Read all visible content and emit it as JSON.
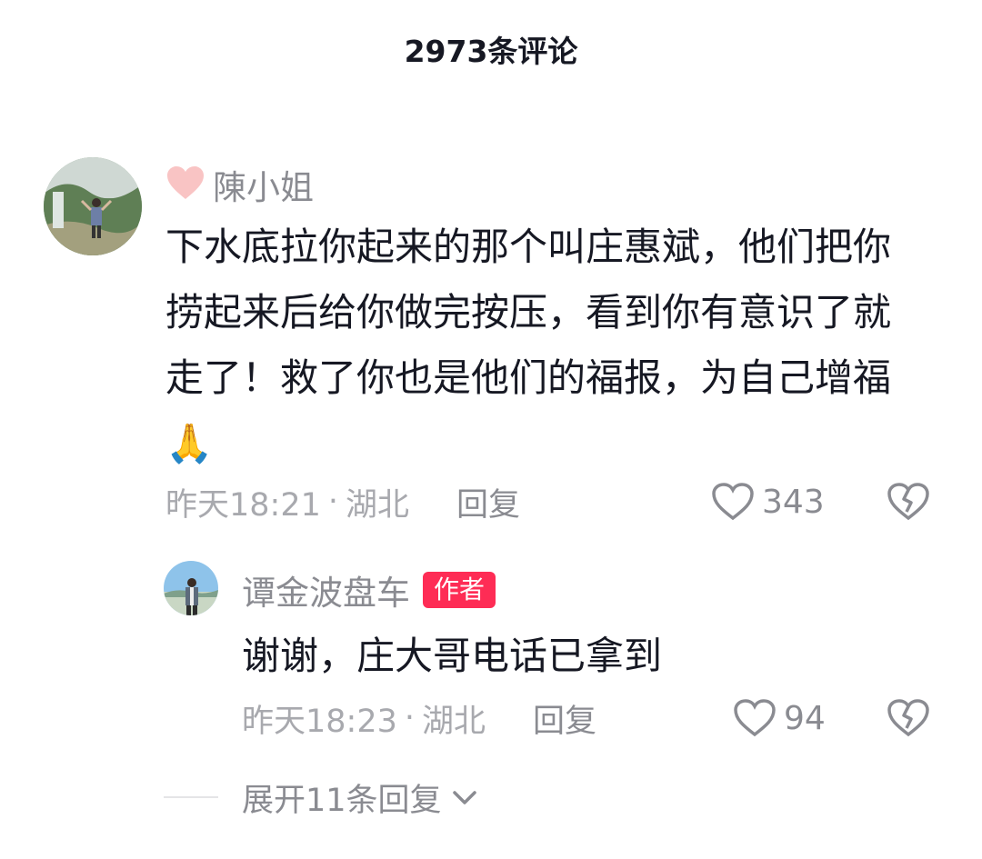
{
  "header": {
    "title": "2973条评论"
  },
  "comment": {
    "username": "陳小姐",
    "text": "下水底拉你起来的那个叫庄惠斌，他们把你捞起来后给你做完按压，看到你有意识了就走了！救了你也是他们的福报，为自己增福🙏",
    "time": "昨天18:21",
    "separator": "·",
    "location": "湖北",
    "reply_label": "回复",
    "like_count": "343"
  },
  "reply": {
    "username": "谭金波盘车",
    "author_tag": "作者",
    "text": "谢谢，庄大哥电话已拿到",
    "time": "昨天18:23",
    "separator": "·",
    "location": "湖北",
    "reply_label": "回复",
    "like_count": "94"
  },
  "expand": {
    "label": "展开11条回复"
  },
  "colors": {
    "accent": "#fe2c55",
    "muted": "#a8a9ae",
    "text": "#161823"
  }
}
